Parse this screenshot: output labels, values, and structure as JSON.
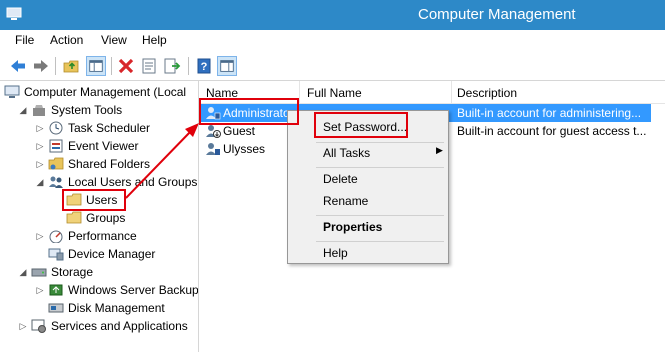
{
  "window": {
    "title": "Computer Management"
  },
  "menu": [
    {
      "id": "file",
      "label": "File"
    },
    {
      "id": "action",
      "label": "Action"
    },
    {
      "id": "view",
      "label": "View"
    },
    {
      "id": "help",
      "label": "Help"
    }
  ],
  "toolbar": {
    "icons": [
      "back-arrow-icon",
      "forward-arrow-icon",
      "up-folder-icon",
      "show-hide-tree-icon",
      "delete-icon",
      "properties-icon",
      "export-list-icon",
      "help-icon",
      "show-hide-action-pane-icon"
    ]
  },
  "tree": {
    "root": "Computer Management (Local",
    "system_tools": "System Tools",
    "task_scheduler": "Task Scheduler",
    "event_viewer": "Event Viewer",
    "shared_folders": "Shared Folders",
    "local_users_groups": "Local Users and Groups",
    "users": "Users",
    "groups": "Groups",
    "performance": "Performance",
    "device_manager": "Device Manager",
    "storage": "Storage",
    "windows_server_backup": "Windows Server Backup",
    "disk_management": "Disk Management",
    "services_apps": "Services and Applications"
  },
  "list": {
    "columns": {
      "name": "Name",
      "full_name": "Full Name",
      "description": "Description"
    },
    "rows": [
      {
        "name": "Administrator",
        "full_name": "",
        "description": "Built-in account for administering..."
      },
      {
        "name": "Guest",
        "full_name": "",
        "description": "Built-in account for guest access t..."
      },
      {
        "name": "Ulysses",
        "full_name": "",
        "description": ""
      }
    ]
  },
  "context_menu": {
    "set_password": "Set Password...",
    "all_tasks": "All Tasks",
    "delete": "Delete",
    "rename": "Rename",
    "properties": "Properties",
    "help": "Help"
  },
  "colors": {
    "titlebar": "#2d89c8",
    "selection": "#3399ff",
    "annotation": "#e0000b"
  }
}
